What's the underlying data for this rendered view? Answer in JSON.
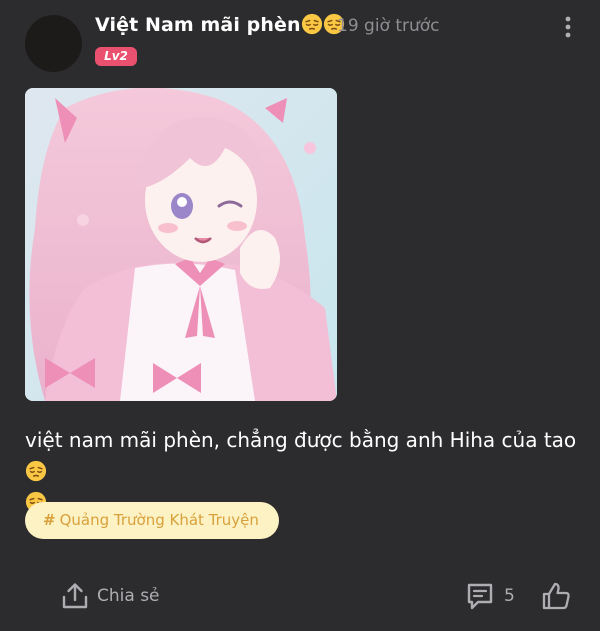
{
  "post": {
    "author_name": "Việt Nam mãi phèn",
    "author_emoji": "relieved-face-emoji",
    "timestamp": "19 giờ trước",
    "level_badge": "Lv2",
    "image_icon": "anime-girl-illustration",
    "content_text": "việt nam mãi phèn, chẳng được bằng anh Hiha của tao",
    "tag": {
      "hash_symbol": "#",
      "label": "Quảng Trường Khát Truyện"
    }
  },
  "actions": {
    "share_label": "Chia sẻ",
    "share_icon": "share-upload-icon",
    "comment_count": "5",
    "comment_icon": "comment-icon",
    "like_icon": "thumbs-up-icon",
    "more_icon": "more-vertical-icon"
  },
  "colors": {
    "background": "#2c2c2e",
    "badge": "#e9516f",
    "tag_bg": "#fdf2c4",
    "tag_text": "#d8a13c",
    "muted": "#aeaeb2"
  }
}
